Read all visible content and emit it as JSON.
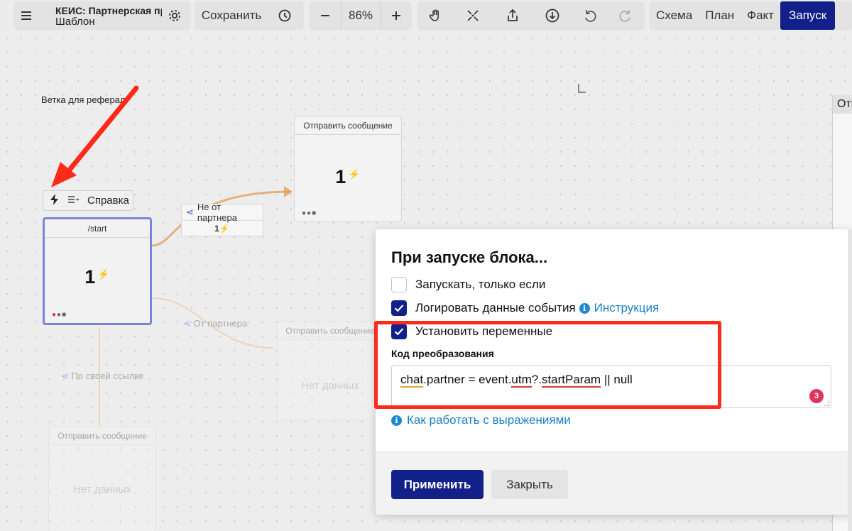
{
  "toolbar": {
    "title": "КЕИС: Партнерская прог",
    "subtitle": "Шаблон",
    "save_label": "Сохранить",
    "zoom": "86%",
    "tabs": [
      {
        "label": "Схема"
      },
      {
        "label": "План"
      },
      {
        "label": "Факт"
      },
      {
        "label": "Запуск"
      }
    ]
  },
  "canvas": {
    "branch_label": "Ветка для реферал",
    "trigger_bar_label": "Справка",
    "start_node": {
      "title": "/start",
      "count": "1"
    },
    "send_node": {
      "title": "Отправить сообщение",
      "count": "1"
    },
    "edge_not_partner": {
      "label": "Не от партнера",
      "count": "1"
    },
    "edge_partner": {
      "label": "От партнера"
    },
    "edge_own_link": {
      "label": "По своей ссылке"
    },
    "faded_node_1": {
      "title": "Отправить сообщение",
      "empty": "Нет данных"
    },
    "faded_node_2": {
      "title": "Отправить сообщение",
      "empty": "Нет данных"
    },
    "side_panel_title": "Отп"
  },
  "modal": {
    "title": "При запуске блока...",
    "options": [
      {
        "label": "Запускать, только если",
        "checked": false
      },
      {
        "label": "Логировать данные события",
        "checked": true,
        "link": "Инструкция"
      },
      {
        "label": "Установить переменные",
        "checked": true
      }
    ],
    "code_label": "Код преобразования",
    "code": {
      "part1": "chat",
      "part2": ".partner = event.",
      "part3": "utm",
      "part4": "?.",
      "part5": "startParam",
      "part6": " || null"
    },
    "error_count": "3",
    "help_link": "Как работать с выражениями",
    "apply_label": "Применить",
    "close_label": "Закрыть"
  },
  "colors": {
    "accent": "#12208a",
    "highlight": "#ff2a1a",
    "link": "#1a7fc4",
    "error": "#e0355e"
  }
}
